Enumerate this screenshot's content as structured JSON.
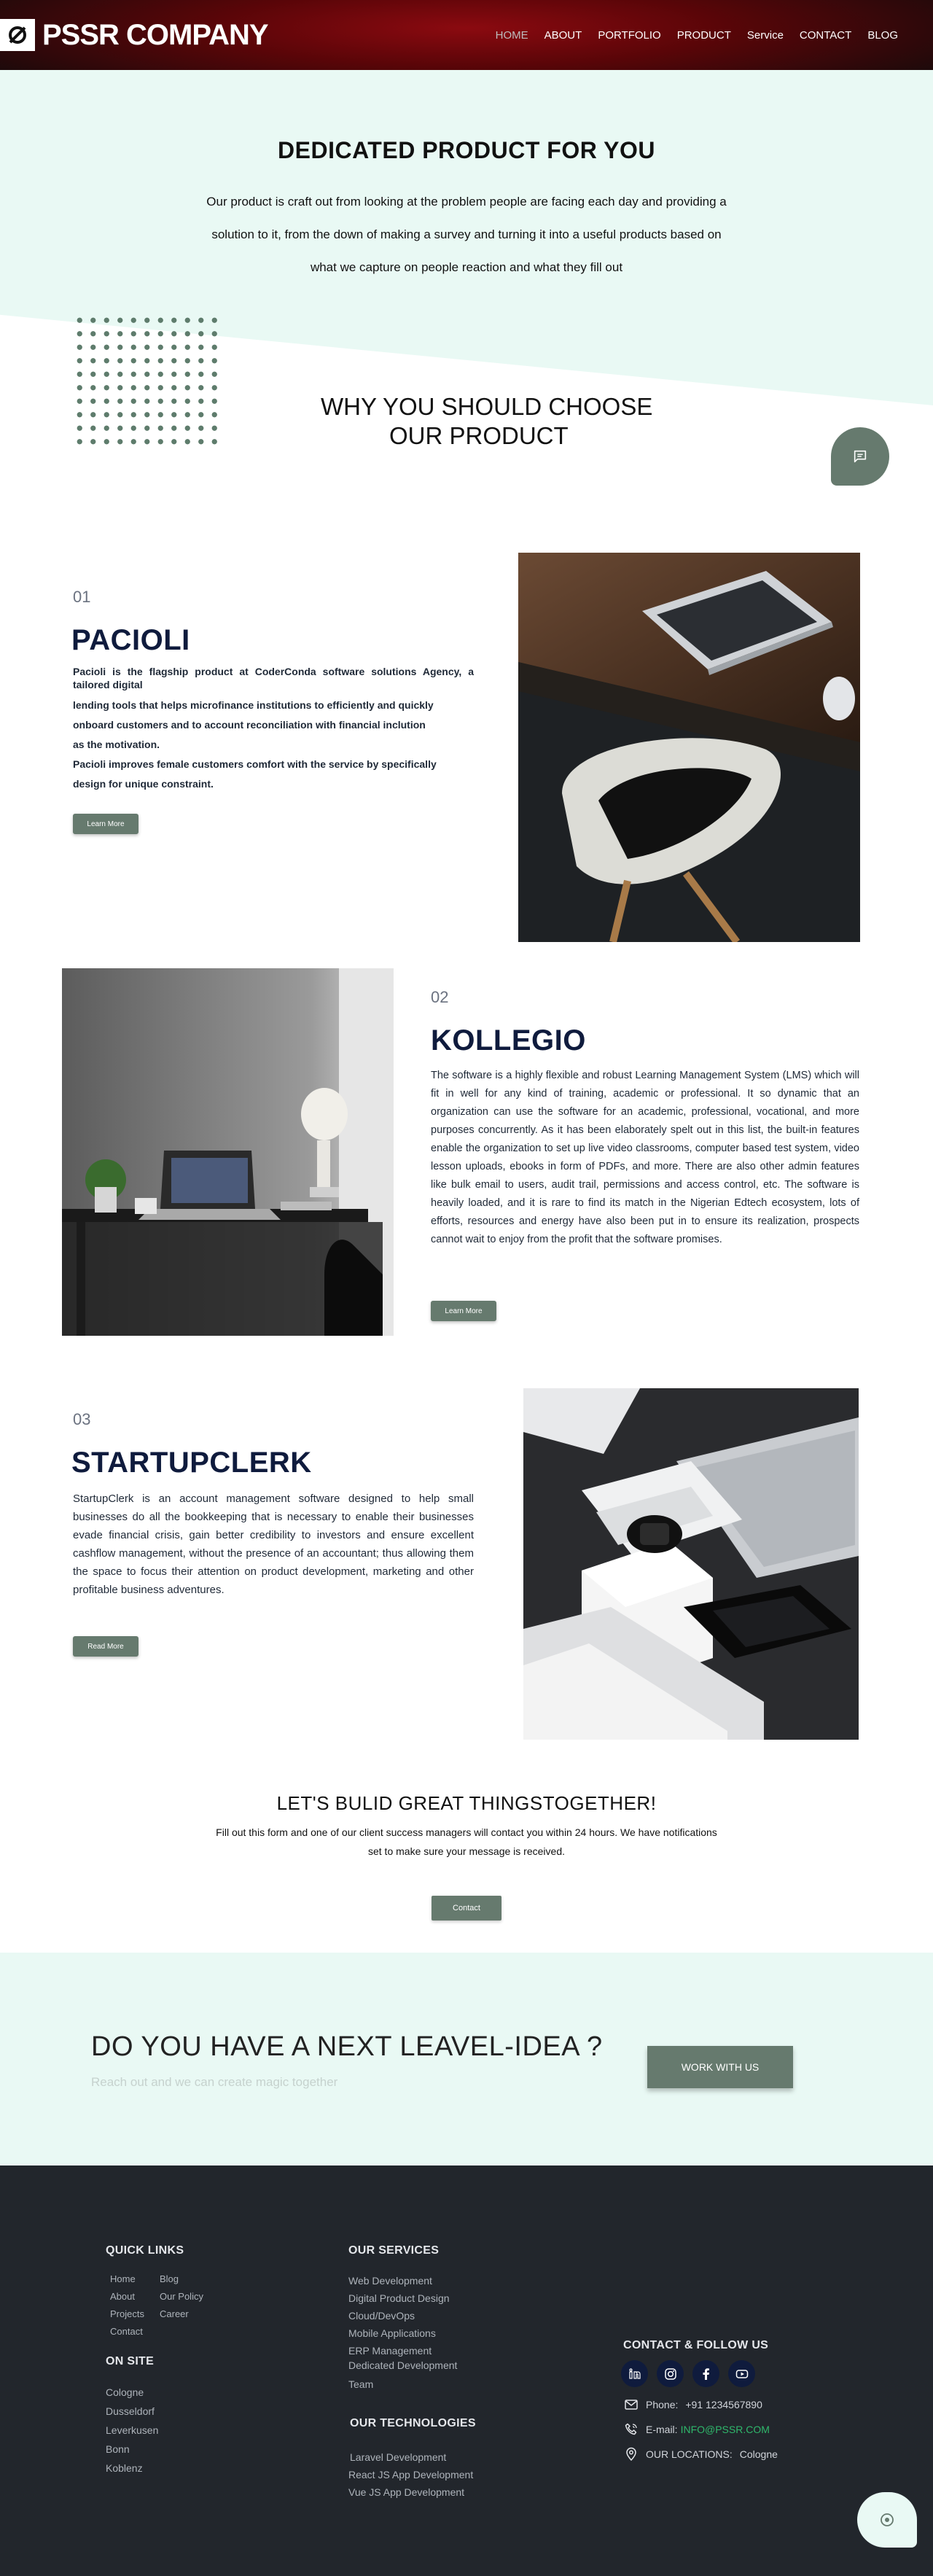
{
  "brand": {
    "name": "PSSR COMPANY"
  },
  "nav": {
    "items": [
      {
        "label": "HOME",
        "active": true
      },
      {
        "label": "ABOUT"
      },
      {
        "label": "PORTFOLIO"
      },
      {
        "label": "PRODUCT"
      },
      {
        "label": "Service"
      },
      {
        "label": "CONTACT"
      },
      {
        "label": "BLOG"
      }
    ]
  },
  "hero": {
    "title": "DEDICATED PRODUCT FOR YOU",
    "text": "Our product is craft out from looking at the problem people are facing each day and providing a solution to it, from the down of making a survey and turning it into a useful products based on what we capture on people reaction and what they fill out"
  },
  "why": {
    "line1": "WHY YOU SHOULD CHOOSE",
    "line2": "OUR PRODUCT"
  },
  "products": [
    {
      "num": "01",
      "title": "PACIOLI",
      "paragraphs": [
        "Pacioli is the flagship product at CoderConda software solutions Agency, a tailored digital",
        "lending tools that helps microfinance institutions to efficiently and quickly",
        "onboard customers and to account reconciliation with financial inclution",
        "as the motivation.",
        "Pacioli improves female customers comfort with the service by specifically",
        "design for unique constraint."
      ],
      "button": "Learn More"
    },
    {
      "num": "02",
      "title": "KOLLEGIO",
      "paragraphs": [
        "The software is a highly flexible and robust Learning Management System (LMS) which will fit in well for any kind of training, academic or professional. It so dynamic that an organization can use the software for an academic, professional, vocational, and more purposes concurrently. As it has been elaborately spelt out in this list, the built-in features enable the organization to set up live video classrooms, computer based test system, video lesson uploads, ebooks in form of PDFs, and more. There are also other admin features like bulk email to users, audit trail, permissions and access control, etc. The software is heavily loaded, and it is rare to find its match in the Nigerian Edtech ecosystem, lots of efforts, resources and energy have also been put in to ensure its realization, prospects cannot wait to enjoy from the profit that the software promises."
      ],
      "button": "Learn More"
    },
    {
      "num": "03",
      "title": "STARTUPCLERK",
      "paragraphs": [
        "StartupClerk is an account management software designed to help small businesses do all the bookkeeping that is necessary to enable their businesses evade financial crisis, gain better credibility to investors and ensure excellent cashflow management, without the presence of an accountant; thus allowing them the space to focus their attention on product development, marketing and other profitable business adventures."
      ],
      "button": "Read More"
    }
  ],
  "cta": {
    "title": "LET'S BULID GREAT THINGSTOGETHER!",
    "text": "Fill out this form and one of our client success managers will contact you within 24 hours. We have notifications set to make sure your message is received.",
    "button": "Contact"
  },
  "idea": {
    "title": "DO YOU HAVE A NEXT LEAVEL-IDEA ?",
    "subtitle": "Reach out and we can create magic together",
    "button": "WORK WITH US"
  },
  "footer": {
    "quick_links": {
      "title": "QUICK LINKS",
      "col1": [
        "Home",
        "About",
        "Projects",
        "Contact"
      ],
      "col2": [
        "Blog",
        "Our Policy",
        "Career"
      ]
    },
    "on_site": {
      "title": "ON SITE",
      "items": [
        "Cologne",
        "Dusseldorf",
        "Leverkusen",
        "Bonn",
        "Koblenz"
      ]
    },
    "services": {
      "title": "OUR SERVICES",
      "items": [
        "Web Development",
        "Digital Product Design",
        "Cloud/DevOps",
        "Mobile Applications",
        "ERP Management",
        "Dedicated Development",
        "Team"
      ]
    },
    "technologies": {
      "title": "OUR TECHNOLOGIES",
      "items": [
        "Laravel Development",
        "React JS App Development",
        "Vue JS App Development"
      ]
    },
    "contact": {
      "title": "CONTACT & FOLLOW US",
      "phone_label": "Phone:",
      "phone": "+91 1234567890",
      "email_label": "E-mail:",
      "email": "INFO@PSSR.COM",
      "location_label": "OUR LOCATIONS:",
      "location": "Cologne",
      "social": [
        "linkedin-icon",
        "instagram-icon",
        "facebook-icon",
        "youtube-icon"
      ]
    }
  },
  "colors": {
    "accent": "#667a6e",
    "mint": "#e9f9f4",
    "navy": "#0f1b3d",
    "footer_bg": "#22262c",
    "email_green": "#2fb86b"
  }
}
